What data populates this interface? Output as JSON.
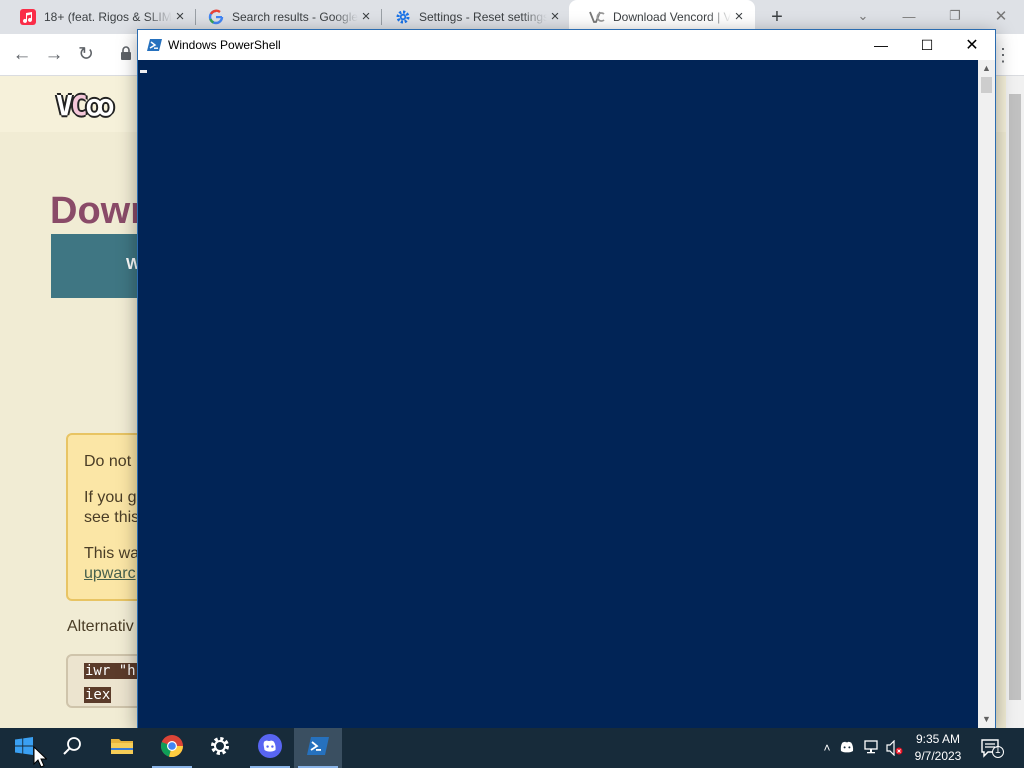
{
  "browser": {
    "tabs": [
      {
        "title": "18+ (feat. Rigos & SLIM",
        "icon": "music-icon",
        "active": false
      },
      {
        "title": "Search results - Google",
        "icon": "google-icon",
        "active": false
      },
      {
        "title": "Settings - Reset settings",
        "icon": "gear-icon",
        "active": false
      },
      {
        "title": "Download Vencord | Vencord",
        "icon": "vencord-icon",
        "active": true
      }
    ],
    "new_tab_glyph": "+",
    "tab_close_glyph": "×",
    "window_controls": {
      "tab_search": "⌄",
      "minimize": "—",
      "restore": "❐",
      "close": "✕"
    },
    "nav": {
      "back": "←",
      "forward": "→",
      "reload": "↻",
      "lock": "🔒",
      "menu": "⋮"
    }
  },
  "page": {
    "logo_letters": [
      "V",
      "C",
      "ꝏ"
    ],
    "heading": "Down",
    "platform_tab": "W",
    "warning": {
      "line1": "Do not",
      "line2a": "If you g",
      "line2b": "see this",
      "line3a": "This wa",
      "link": "upwarc"
    },
    "alt_label": "Alternativ",
    "code": [
      "iwr \"h",
      "iex"
    ]
  },
  "powershell": {
    "title": "Windows PowerShell",
    "controls": {
      "minimize": "—",
      "maximize": "☐",
      "close": "✕"
    },
    "scroll_up": "▲",
    "scroll_down": "▼",
    "console_bg": "#012456"
  },
  "taskbar": {
    "apps": [
      {
        "name": "start",
        "icon": "windows-start-icon"
      },
      {
        "name": "search",
        "icon": "search-icon"
      },
      {
        "name": "file-explorer",
        "icon": "folder-icon"
      },
      {
        "name": "chrome",
        "icon": "chrome-icon"
      },
      {
        "name": "settings",
        "icon": "gear-icon"
      },
      {
        "name": "discord",
        "icon": "discord-icon"
      },
      {
        "name": "powershell",
        "icon": "powershell-icon"
      }
    ],
    "tray_chevron": "˄",
    "time": "9:35 AM",
    "date": "9/7/2023",
    "notification_count": "1"
  },
  "colors": {
    "accent": "#2b6cb0",
    "taskbar": "#172b3a",
    "page_bg": "#f1ecd4",
    "heading": "#8a4b68"
  }
}
